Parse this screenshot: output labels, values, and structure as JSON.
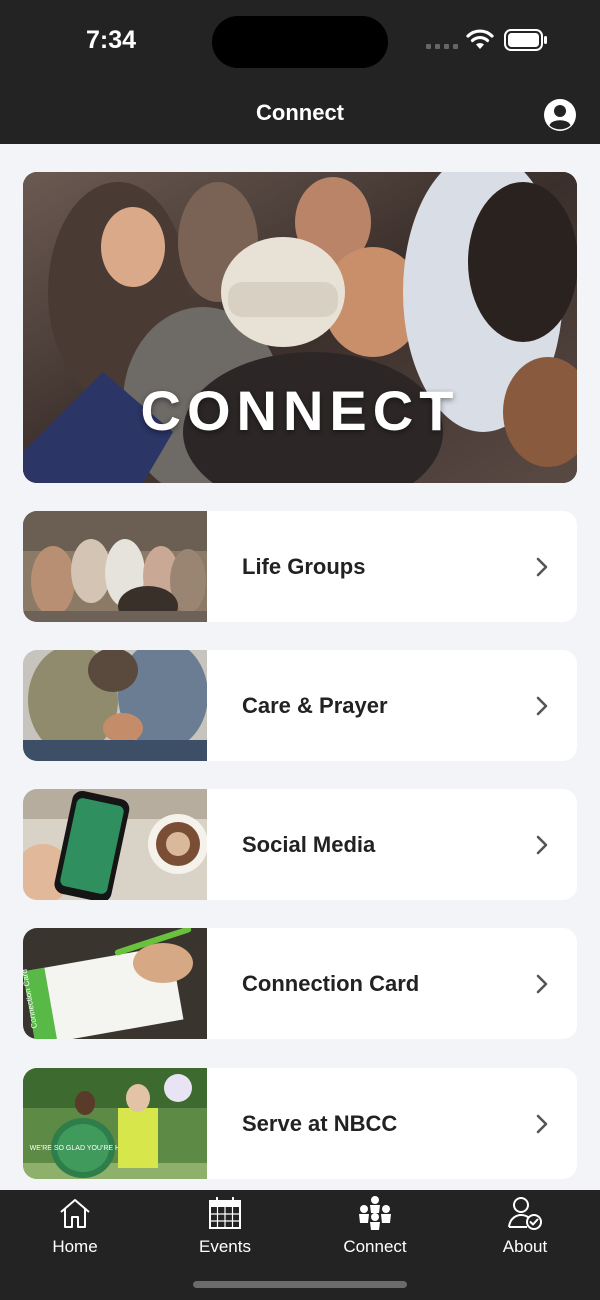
{
  "status_bar": {
    "time": "7:34"
  },
  "header": {
    "title": "Connect",
    "profile_icon": "person-circle-icon"
  },
  "hero": {
    "title": "CONNECT"
  },
  "menu": {
    "items": [
      {
        "label": "Life Groups",
        "thumb_icon": "life-groups-photo",
        "chevron": "chevron-right-icon"
      },
      {
        "label": "Care & Prayer",
        "thumb_icon": "care-prayer-photo",
        "chevron": "chevron-right-icon"
      },
      {
        "label": "Social Media",
        "thumb_icon": "social-media-photo",
        "chevron": "chevron-right-icon"
      },
      {
        "label": "Connection Card",
        "thumb_icon": "connection-card-photo",
        "chevron": "chevron-right-icon",
        "card_text": "Connection Card"
      },
      {
        "label": "Serve at NBCC",
        "thumb_icon": "serve-photo",
        "chevron": "chevron-right-icon",
        "sign_text": "WE'RE SO GLAD YOU'RE HERE!"
      }
    ]
  },
  "tab_bar": {
    "tabs": [
      {
        "label": "Home",
        "icon": "home-icon"
      },
      {
        "label": "Events",
        "icon": "calendar-icon"
      },
      {
        "label": "Connect",
        "icon": "people-icon"
      },
      {
        "label": "About",
        "icon": "person-check-icon"
      }
    ]
  },
  "colors": {
    "bar_bg": "#232323",
    "page_bg": "#f3f4f8",
    "card_bg": "#ffffff",
    "text": "#222222",
    "accent_green": "#58b947"
  }
}
